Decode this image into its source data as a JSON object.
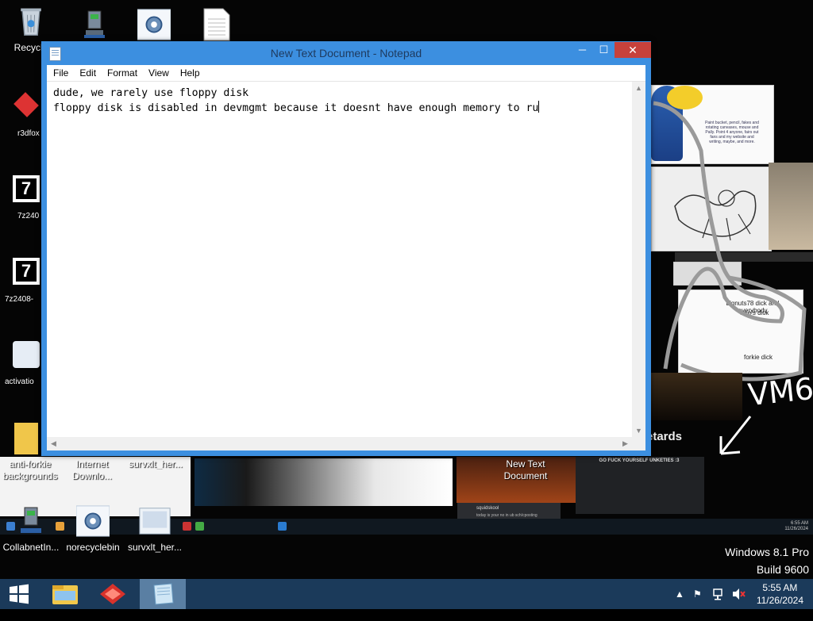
{
  "desktop": {
    "icons_top": [
      {
        "name": "recycle-bin",
        "label": "Recycle"
      },
      {
        "name": "network-computer",
        "label": ""
      },
      {
        "name": "settings-app",
        "label": ""
      },
      {
        "name": "text-document",
        "label": ""
      }
    ],
    "icons_bottom_row1": [
      {
        "label": "anti-forkie backgrounds"
      },
      {
        "label": "Internet Downlo..."
      },
      {
        "label": "survxlt_her..."
      },
      {
        "label": "New Text Document"
      }
    ],
    "icons_bottom_row2": [
      {
        "label": "CollabnetIn..."
      },
      {
        "label": "norecyclebin"
      },
      {
        "label": "survxlt_her..."
      }
    ],
    "left_strip_labels": [
      "r3dfox",
      "7z240",
      "7z2408-",
      "activatio"
    ],
    "wallpaper_text": {
      "panel1": "Paint bucket, pencil, fakes and rotating canvases, mouse and Pally. Point 4 anyone, fairs out fans and my website and writing, maybe, and more.",
      "panel2_line1": "bignuts78 dick and everybody",
      "panel2_line2": "else's dick",
      "panel2_line3": "forkie dick",
      "vm": "VM6",
      "retards": "etards",
      "banner": "GO FUCK YOURSELF UNKETIES :3",
      "chat_user": "squidskool",
      "chat_msg": "today is your no in ub sch/cposting",
      "mini_time": "6:55 AM",
      "mini_date": "11/26/2024"
    },
    "edition": {
      "line1": "Windows 8.1 Pro",
      "line2": "Build 9600"
    }
  },
  "notepad": {
    "title": "New Text Document - Notepad",
    "buttons": {
      "minimize": "─",
      "maximize": "☐",
      "close": "✕"
    },
    "menu": [
      "File",
      "Edit",
      "Format",
      "View",
      "Help"
    ],
    "text_line1": "dude, we rarely use floppy disk",
    "text_line2": "floppy disk is disabled in devmgmt because it doesnt have enough memory to ru"
  },
  "taskbar": {
    "items": [
      {
        "name": "file-explorer-icon"
      },
      {
        "name": "r3dfox-icon"
      },
      {
        "name": "notepad-icon",
        "active": true
      }
    ],
    "tray_icons": [
      "chevron-up-icon",
      "flag-icon",
      "network-icon",
      "volume-muted-icon"
    ],
    "time": "5:55 AM",
    "date": "11/26/2024"
  },
  "colors": {
    "window_frame": "#3c8fe0",
    "close_button": "#c7413b",
    "taskbar": "#1b3a5a",
    "taskbar_active": "#5a7fa3"
  }
}
